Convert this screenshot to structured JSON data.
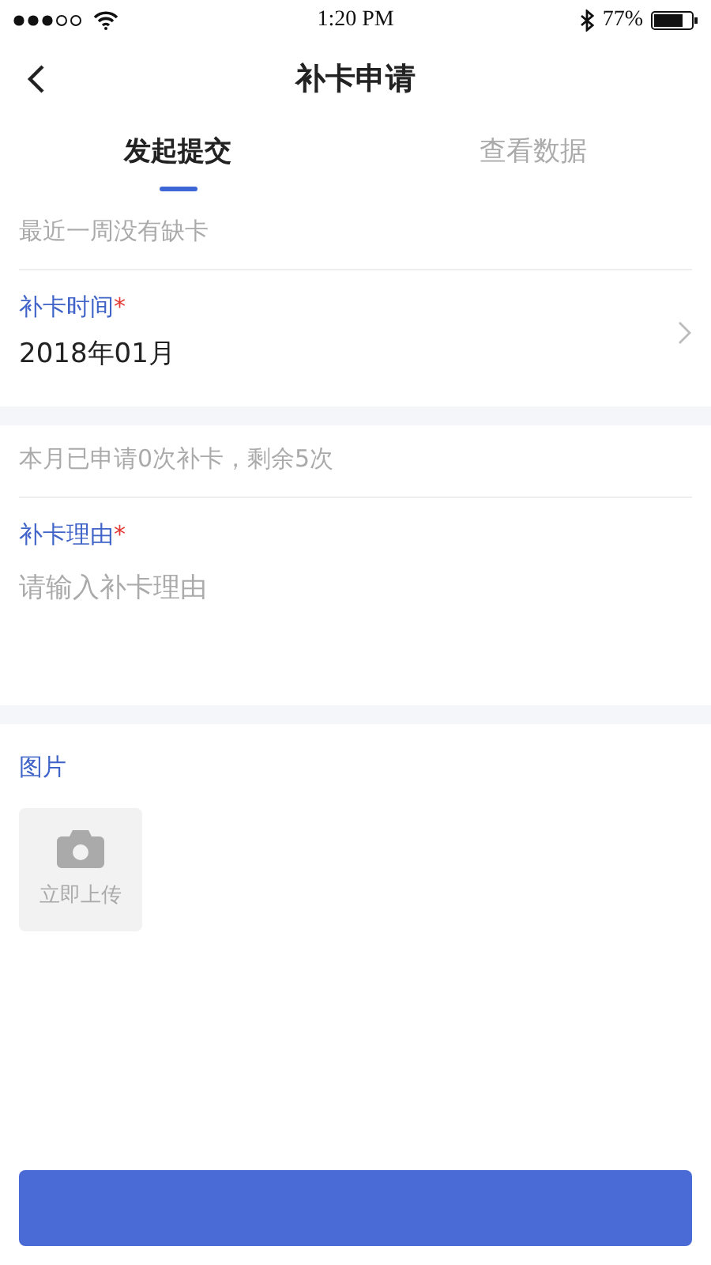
{
  "status_bar": {
    "time": "1:20 PM",
    "battery": "77%"
  },
  "nav": {
    "title": "补卡申请"
  },
  "tabs": [
    {
      "label": "发起提交",
      "selected": true
    },
    {
      "label": "查看数据",
      "selected": false
    }
  ],
  "notice": "最近一周没有缺卡",
  "time_field": {
    "label": "补卡时间",
    "required_mark": "*",
    "value": "2018年01月"
  },
  "quota": "本月已申请0次补卡，剩余5次",
  "reason_field": {
    "label": "补卡理由",
    "required_mark": "*",
    "placeholder": "请输入补卡理由"
  },
  "images": {
    "label": "图片",
    "upload": "立即上传"
  },
  "submit": {
    "kind": "button"
  }
}
